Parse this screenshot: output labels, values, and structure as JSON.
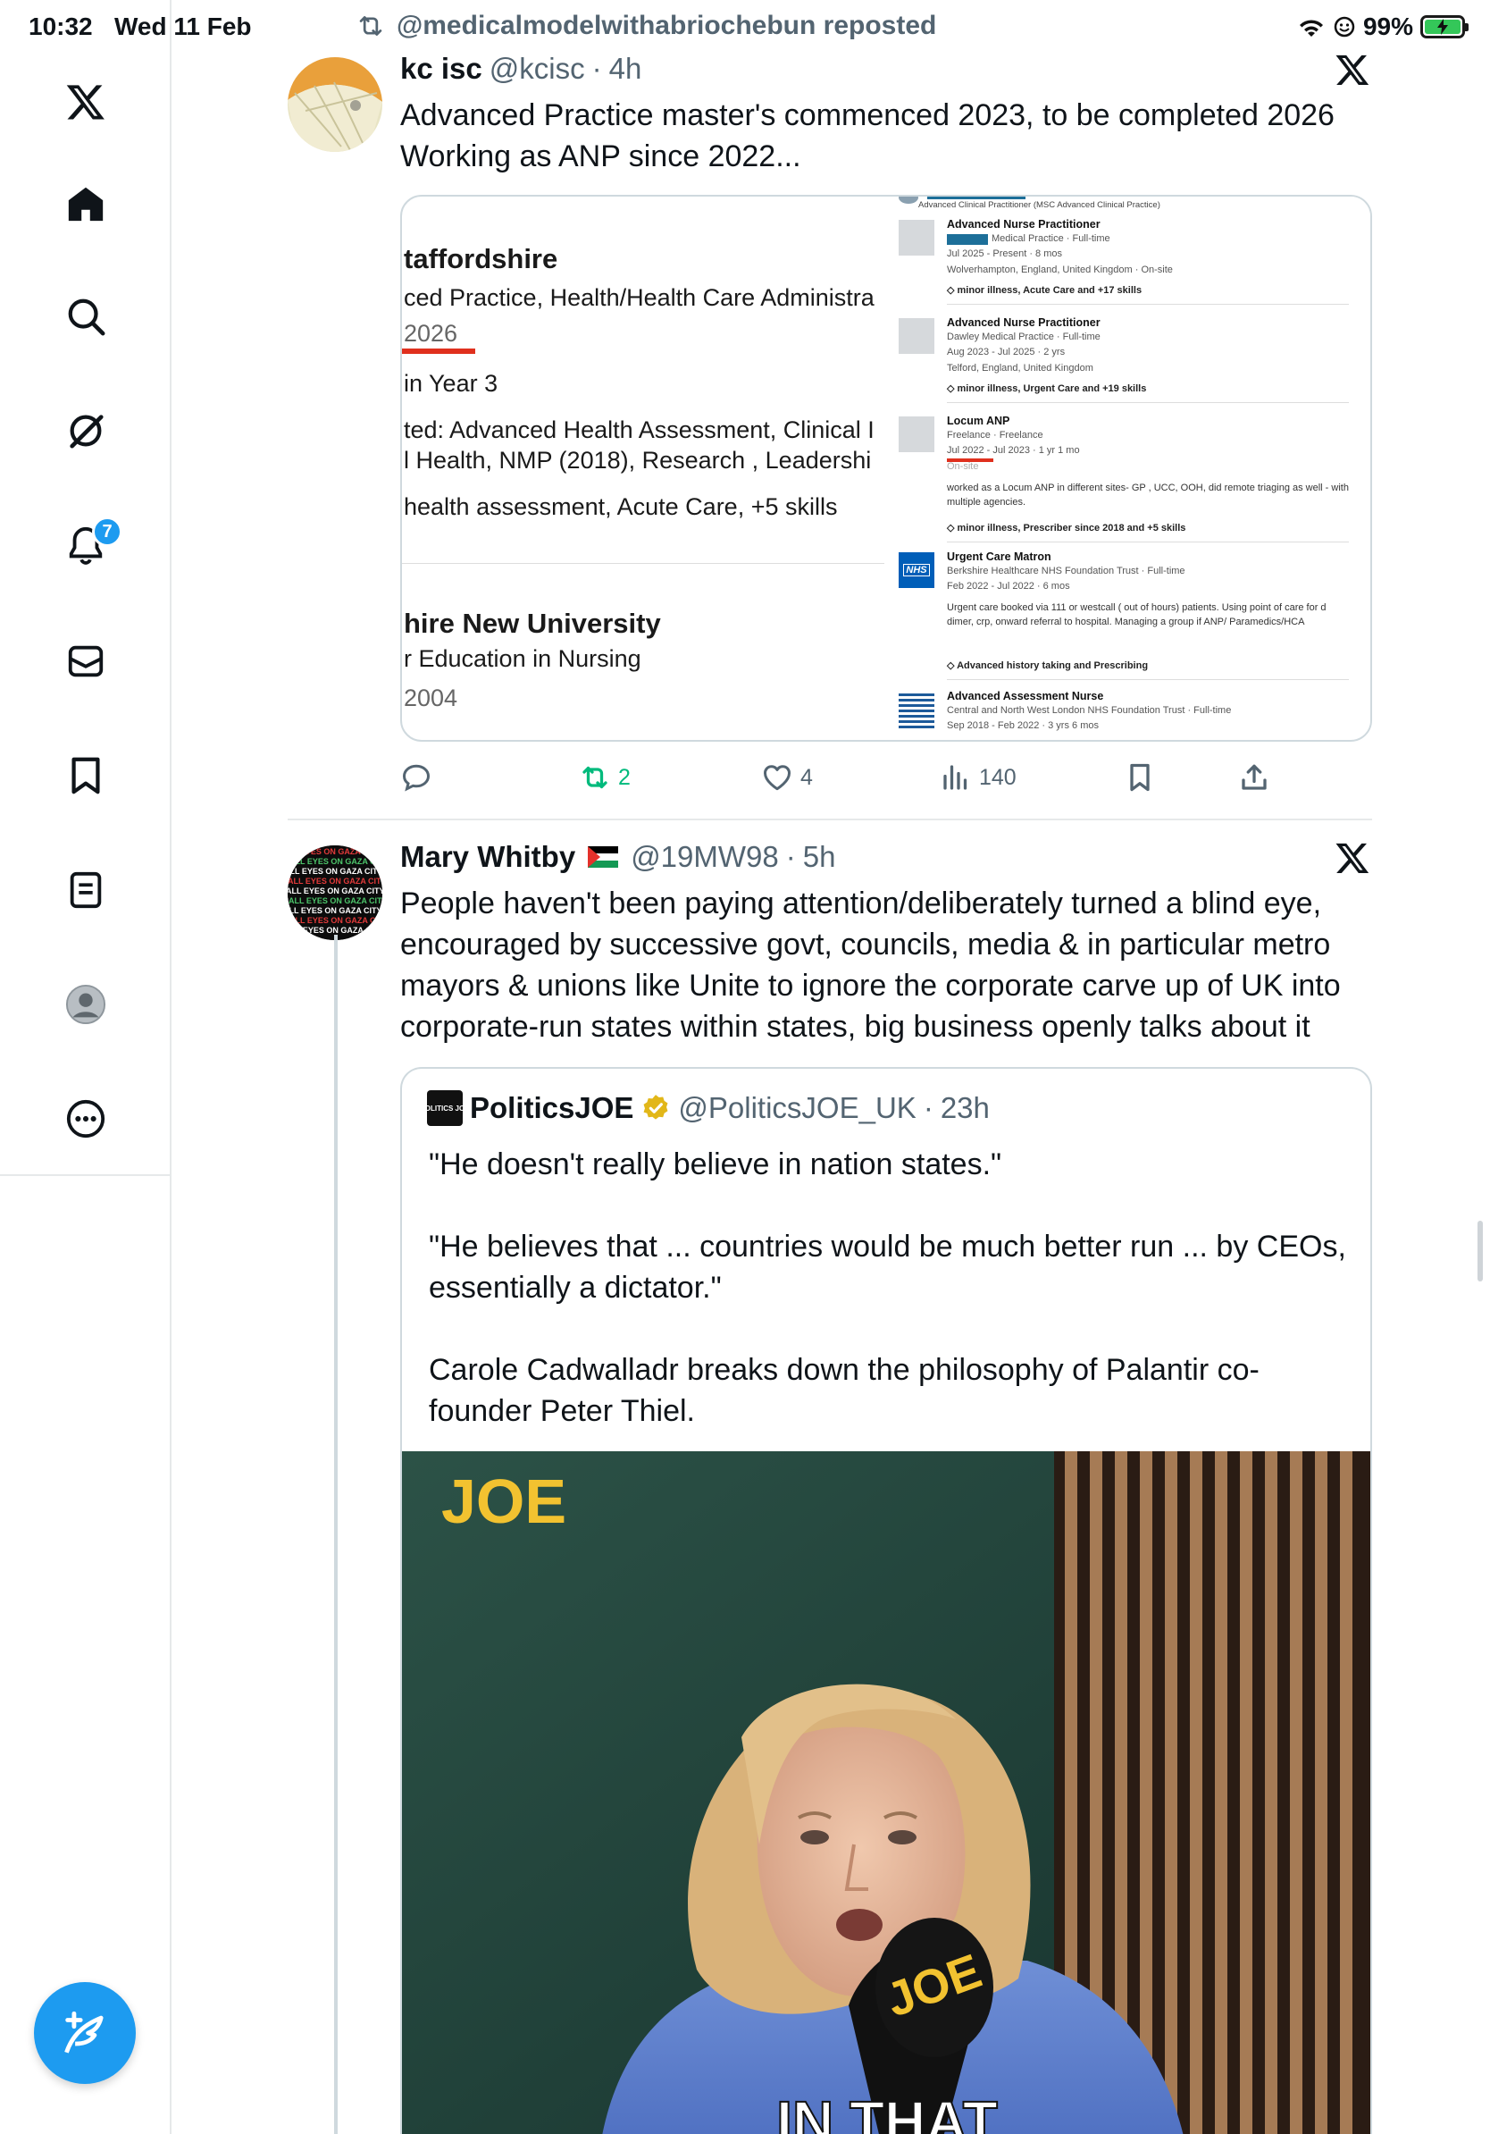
{
  "status_bar": {
    "time": "10:32",
    "date": "Wed 11 Feb",
    "battery": "99%"
  },
  "sidebar": {
    "items": [
      {
        "name": "x-logo"
      },
      {
        "name": "home"
      },
      {
        "name": "search"
      },
      {
        "name": "grok"
      },
      {
        "name": "notifications",
        "badge": "7"
      },
      {
        "name": "messages"
      },
      {
        "name": "bookmarks"
      },
      {
        "name": "lists"
      },
      {
        "name": "profile"
      },
      {
        "name": "more"
      }
    ],
    "compose_icon": "compose-icon"
  },
  "repost_banner": {
    "text": "@medicalmodelwithabriochebun reposted"
  },
  "tweet1": {
    "name": "kc isc",
    "handle": "@kcisc",
    "time": "4h",
    "text_line1": "Advanced Practice master's commenced 2023, to be completed 2026",
    "text_line2": "Working as ANP since 2022...",
    "image": {
      "left": {
        "school1": "taffordshire",
        "degree1": "ced Practice, Health/Health Care Administra",
        "year1": "2026",
        "status1": "in Year 3",
        "modules1": "ted: Advanced Health Assessment, Clinical I",
        "modules2": "l Health, NMP (2018), Research , Leadershi",
        "skills1": "health assessment, Acute Care, +5 skills",
        "school2": "hire New University",
        "degree2": "r Education in Nursing",
        "year2": "2004"
      },
      "right": {
        "header": "Advanced Clinical Practitioner (MSC Advanced Clinical Practice)",
        "entries": [
          {
            "title": "Advanced Nurse Practitioner",
            "l1": "Medical Practice · Full-time",
            "l2": "Jul 2025 - Present · 8 mos",
            "l3": "Wolverhampton, England, United Kingdom · On-site",
            "skills": "minor illness, Acute Care and +17 skills"
          },
          {
            "title": "Advanced Nurse Practitioner",
            "l1": "Dawley Medical Practice · Full-time",
            "l2": "Aug 2023 - Jul 2025 · 2 yrs",
            "l3": "Telford, England, United Kingdom",
            "skills": "minor illness, Urgent Care and +19 skills"
          },
          {
            "title": "Locum ANP",
            "l1": "Freelance · Freelance",
            "l2": "Jul 2022 - Jul 2023 · 1 yr 1 mo",
            "l3": "On-site",
            "body": "worked as a Locum ANP in different sites- GP , UCC, OOH, did remote triaging as well - with multiple agencies.",
            "skills": "minor illness, Prescriber since 2018 and +5 skills"
          },
          {
            "title": "Urgent Care Matron",
            "l1": "Berkshire Healthcare NHS Foundation Trust · Full-time",
            "l2": "Feb 2022 - Jul 2022 · 6 mos",
            "body": "Urgent care booked via 111 or westcall ( out of hours) patients. Using point of care for d dimer, crp, onward referral to hospital. Managing a group if ANP/ Paramedics/HCA",
            "skills": "Advanced history taking and Prescribing",
            "logo": "NHS"
          },
          {
            "title": "Advanced Assessment Nurse",
            "l1": "Central and North West London NHS Foundation Trust · Full-time",
            "l2": "Sep 2018 - Feb 2022 · 3 yrs 6 mos"
          }
        ]
      }
    },
    "actions": {
      "reply": "",
      "repost": "2",
      "like": "4",
      "views": "140"
    }
  },
  "tweet2": {
    "name": "Mary Whitby",
    "handle": "@19MW98",
    "time": "5h",
    "avatar_text": "ALL EYES ON GAZA CITY",
    "lines": [
      "People haven't been paying attention/deliberately turned a blind eye,",
      "encouraged by successive govt, councils, media & in particular metro",
      "mayors & unions like Unite to ignore the corporate carve up of UK into",
      "corporate-run states within states, big business openly talks about it"
    ],
    "quote": {
      "name": "PoliticsJOE",
      "handle": "@PoliticsJOE_UK",
      "time": "23h",
      "avatar_text": "POLITICS JOE",
      "line1": "\"He doesn't really believe in nation states.\"",
      "line2": "\"He believes that ... countries would be much better run ... by CEOs,",
      "line3": "essentially a dictator.\"",
      "line4": "Carole Cadwalladr breaks down the philosophy of Palantir co-",
      "line5": "founder Peter Thiel.",
      "video": {
        "logo": "JOE",
        "mic_logo": "JOE",
        "caption": "IN THAT"
      }
    }
  },
  "colors": {
    "accent": "#1d9bf0",
    "repost_green": "#00ba7c",
    "text": "#0f1419",
    "muted": "#536471",
    "linkedin_red": "#e0301e"
  }
}
